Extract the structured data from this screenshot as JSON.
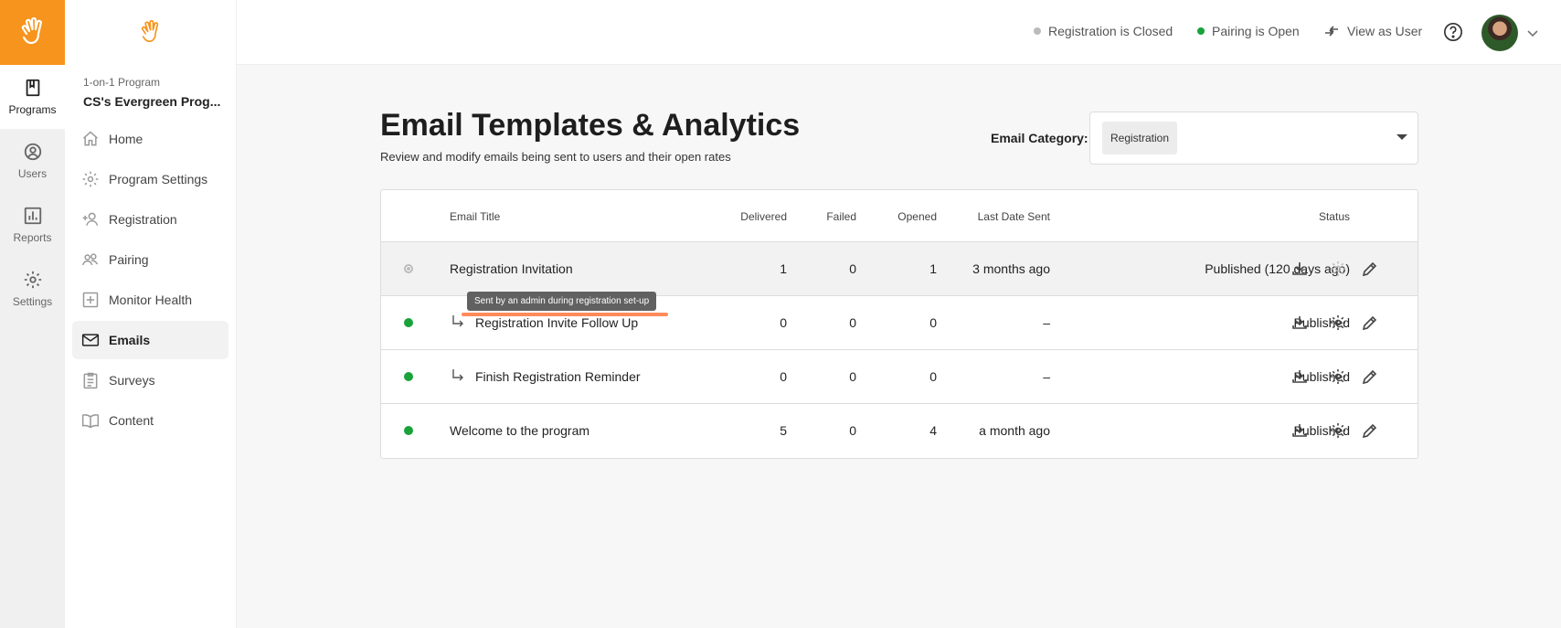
{
  "rail": {
    "items": [
      {
        "label": "Programs",
        "icon": "book-icon"
      },
      {
        "label": "Users",
        "icon": "user-circle-icon"
      },
      {
        "label": "Reports",
        "icon": "bar-chart-icon"
      },
      {
        "label": "Settings",
        "icon": "gear-icon"
      }
    ]
  },
  "sidebar": {
    "program_type": "1-on-1 Program",
    "program_name": "CS's Evergreen Prog...",
    "items": [
      {
        "label": "Home",
        "icon": "home-icon"
      },
      {
        "label": "Program Settings",
        "icon": "gear-icon"
      },
      {
        "label": "Registration",
        "icon": "add-user-icon"
      },
      {
        "label": "Pairing",
        "icon": "users-icon"
      },
      {
        "label": "Monitor Health",
        "icon": "health-plus-icon"
      },
      {
        "label": "Emails",
        "icon": "mail-icon"
      },
      {
        "label": "Surveys",
        "icon": "clipboard-icon"
      },
      {
        "label": "Content",
        "icon": "open-book-icon"
      }
    ]
  },
  "topbar": {
    "registration_status": "Registration is Closed",
    "pairing_status": "Pairing is Open",
    "view_as_user": "View as User"
  },
  "main": {
    "title": "Email Templates & Analytics",
    "subtitle": "Review and modify emails being sent to users and their open rates",
    "category_label": "Email Category:",
    "category_value": "Registration"
  },
  "table": {
    "headers": {
      "title": "Email Title",
      "delivered": "Delivered",
      "failed": "Failed",
      "opened": "Opened",
      "last_sent": "Last Date Sent",
      "status": "Status"
    },
    "rows": [
      {
        "title": "Registration Invitation",
        "delivered": "1",
        "failed": "0",
        "opened": "1",
        "last_sent": "3 months ago",
        "status": "Published (120 days ago)"
      },
      {
        "title": "Registration Invite Follow Up",
        "delivered": "0",
        "failed": "0",
        "opened": "0",
        "last_sent": "–",
        "status": "Published"
      },
      {
        "title": "Finish Registration Reminder",
        "delivered": "0",
        "failed": "0",
        "opened": "0",
        "last_sent": "–",
        "status": "Published"
      },
      {
        "title": "Welcome to the program",
        "delivered": "5",
        "failed": "0",
        "opened": "4",
        "last_sent": "a month ago",
        "status": "Published"
      }
    ]
  },
  "tooltip": "Sent by an admin during registration set-up",
  "colors": {
    "brand_orange": "#f7941d",
    "status_green": "#19a33a",
    "status_grey": "#bbbbbb",
    "tooltip_bg": "#616161",
    "highlight_line": "#ff8a5c"
  }
}
